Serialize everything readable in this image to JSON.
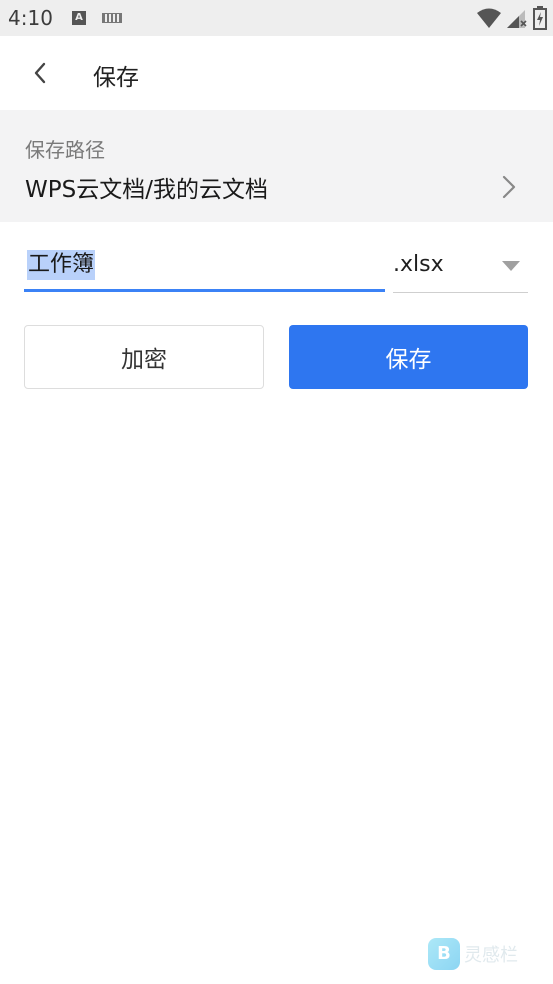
{
  "status_bar": {
    "time": "4:10"
  },
  "app_bar": {
    "title": "保存"
  },
  "save_path": {
    "label": "保存路径",
    "value": "WPS云文档/我的云文档"
  },
  "file": {
    "name": "工作簿",
    "extension": ".xlsx"
  },
  "buttons": {
    "encrypt": "加密",
    "save": "保存"
  },
  "watermark": {
    "logo_letter": "B",
    "text": "灵感栏"
  },
  "colors": {
    "accent": "#2e76f0",
    "selection": "#b9d1fa",
    "panel_bg": "#f3f3f4"
  }
}
